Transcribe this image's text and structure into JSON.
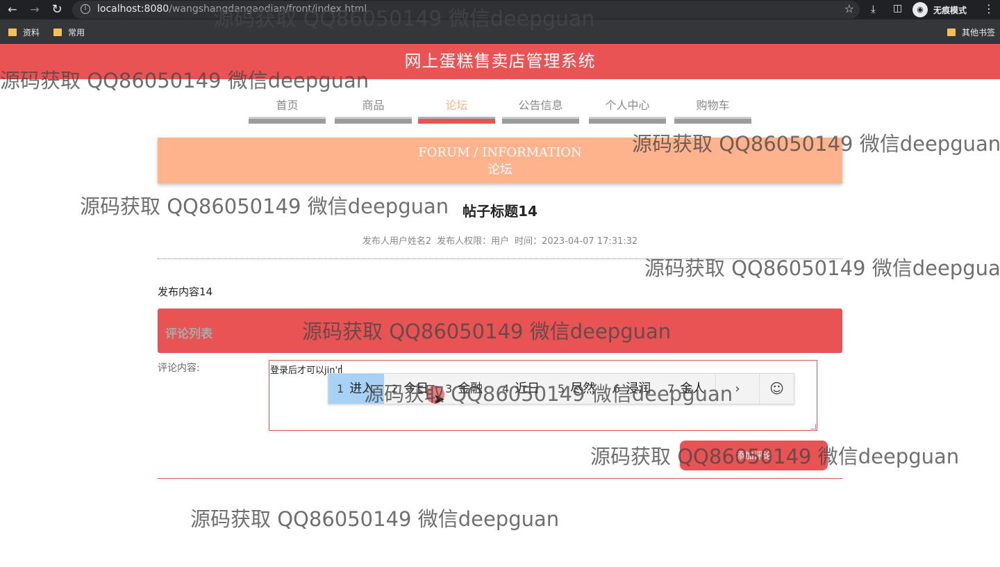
{
  "browser": {
    "back_icon": "arrow-left",
    "forward_icon": "arrow-right",
    "reload_icon": "reload",
    "url_host": "localhost:8080",
    "url_path": "/wangshangdangaodian/front/index.html",
    "incognito_label": "无痕模式",
    "bookmarks": [
      "资料",
      "常用"
    ],
    "other_bookmarks": "其他书签"
  },
  "site": {
    "title": "网上蛋糕售卖店管理系统"
  },
  "nav": {
    "items": [
      {
        "label": "首页",
        "active": false
      },
      {
        "label": "商品",
        "active": false
      },
      {
        "label": "论坛",
        "active": true
      },
      {
        "label": "公告信息",
        "active": false
      },
      {
        "label": "个人中心",
        "active": false
      },
      {
        "label": "购物车",
        "active": false
      }
    ]
  },
  "banner": {
    "en": "FORUM / INFORMATION",
    "cn": "论坛"
  },
  "post": {
    "title": "帖子标题14",
    "author": "发布人用户姓名2",
    "role": "发布人权限：用户",
    "time": "时间：2023-04-07 17:31:32",
    "content": "发布内容14"
  },
  "comments": {
    "header": "评论列表",
    "form_label": "评论内容:",
    "input_value": "登录后才可以jin'r",
    "submit_label": "添加评论"
  },
  "ime": {
    "candidates": [
      "进入",
      "今日",
      "金融",
      "近日",
      "尽然",
      "浸润",
      "金人"
    ],
    "selected_index": 0,
    "next_label": "›",
    "emoji_label": "☺"
  },
  "watermark": "源码获取 QQ86050149 微信deepguan",
  "colors": {
    "brand_red": "#e95354",
    "banner_orange": "#ffb38d",
    "active_nav_text": "#f5b38e"
  }
}
